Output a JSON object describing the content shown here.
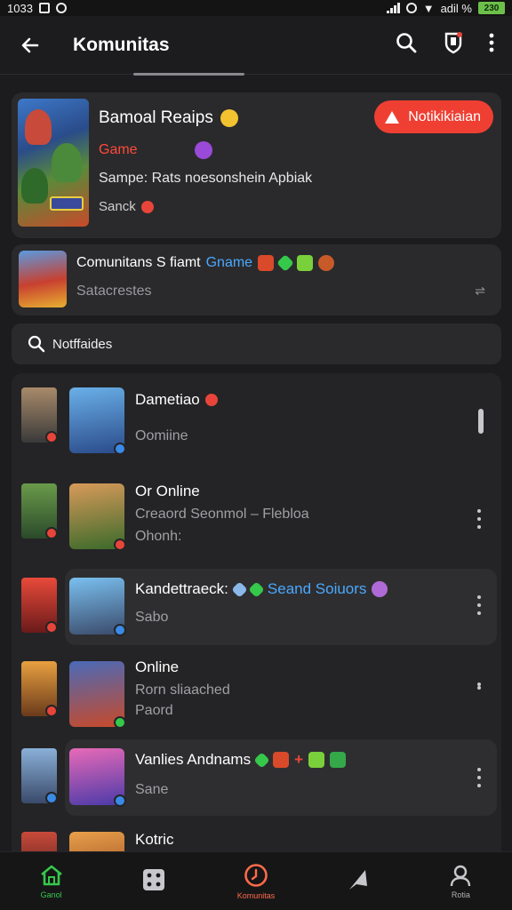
{
  "status_bar": {
    "time": "1033",
    "battery": "230",
    "network": "adil %"
  },
  "app_bar": {
    "title": "Komunitas"
  },
  "game_card": {
    "title": "Bamoal Reaips",
    "subtitle": "Game",
    "description": "Sampe: Rats noesonshein Apbiak",
    "meta": "Sanck",
    "notify_label": "Notikikiaian"
  },
  "community_card": {
    "title": "Comunitans S fiamt",
    "tag": "Gname",
    "subtitle": "Satacrestes"
  },
  "search": {
    "placeholder": "Notffaides"
  },
  "list": [
    {
      "name": "Dametiao",
      "line1": "Oomiine",
      "line2": ""
    },
    {
      "name": "Or Online",
      "line1": "Creaord Seonmol – Flebloa",
      "line2": "Ohonh:"
    },
    {
      "name": "Kandettraeck:",
      "tag": "Seand Soiuors",
      "line1": "Sabo",
      "line2": ""
    },
    {
      "name": "Online",
      "line1": "Rorn sliaached",
      "line2": "Paord"
    },
    {
      "name": "Vanlies Andnams",
      "line1": "Sane",
      "line2": ""
    },
    {
      "name": "Kotric",
      "line1": "",
      "line2": ""
    }
  ],
  "bottom_nav": [
    {
      "label": "Ganol",
      "icon": "home-icon"
    },
    {
      "label": "",
      "icon": "grid-icon"
    },
    {
      "label": "Komunitas",
      "icon": "clock-icon"
    },
    {
      "label": "",
      "icon": "flag-icon"
    },
    {
      "label": "Rotia",
      "icon": "profile-icon"
    }
  ],
  "colors": {
    "accent_red": "#ef3f33",
    "accent_green": "#35c84a",
    "link_blue": "#4aa8ff"
  }
}
